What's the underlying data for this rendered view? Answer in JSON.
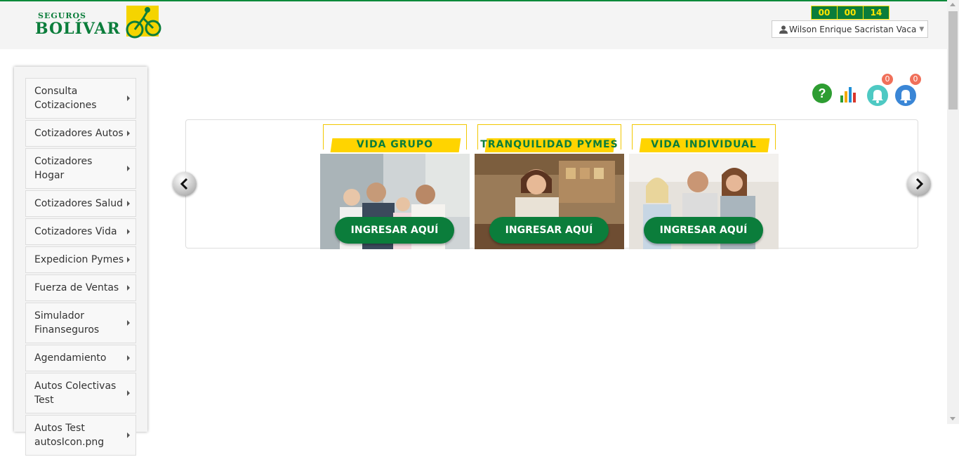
{
  "brand": {
    "small": "SEGUROS",
    "big": "BOLÍVAR"
  },
  "timer": {
    "hours": "00",
    "minutes": "00",
    "seconds": "14"
  },
  "user": {
    "name": "Wilson Enrique Sacristan Vaca"
  },
  "sidebar": {
    "items": [
      {
        "label": "Consulta Cotizaciones"
      },
      {
        "label": "Cotizadores Autos"
      },
      {
        "label": "Cotizadores Hogar"
      },
      {
        "label": "Cotizadores Salud"
      },
      {
        "label": "Cotizadores Vida"
      },
      {
        "label": "Expedicion Pymes"
      },
      {
        "label": "Fuerza de Ventas"
      },
      {
        "label": "Simulador Finanseguros"
      },
      {
        "label": "Agendamiento"
      },
      {
        "label": "Autos Colectivas Test"
      },
      {
        "label": "Autos Test autosIcon.png"
      }
    ]
  },
  "toolbar": {
    "icons": [
      "help-icon",
      "stats-icon",
      "notifications-icon",
      "alerts-icon"
    ],
    "notifications_count": "0",
    "alerts_count": "0"
  },
  "carousel": {
    "cards": [
      {
        "title": "VIDA GRUPO",
        "cta": "INGRESAR AQUÍ"
      },
      {
        "title": "TRANQUILIDAD PYMES",
        "cta": "INGRESAR AQUÍ"
      },
      {
        "title": "VIDA INDIVIDUAL",
        "cta": "INGRESAR AQUÍ"
      }
    ]
  },
  "colors": {
    "brand_green": "#0b7d3b",
    "brand_yellow": "#ffd400",
    "badge": "#f0705a"
  }
}
